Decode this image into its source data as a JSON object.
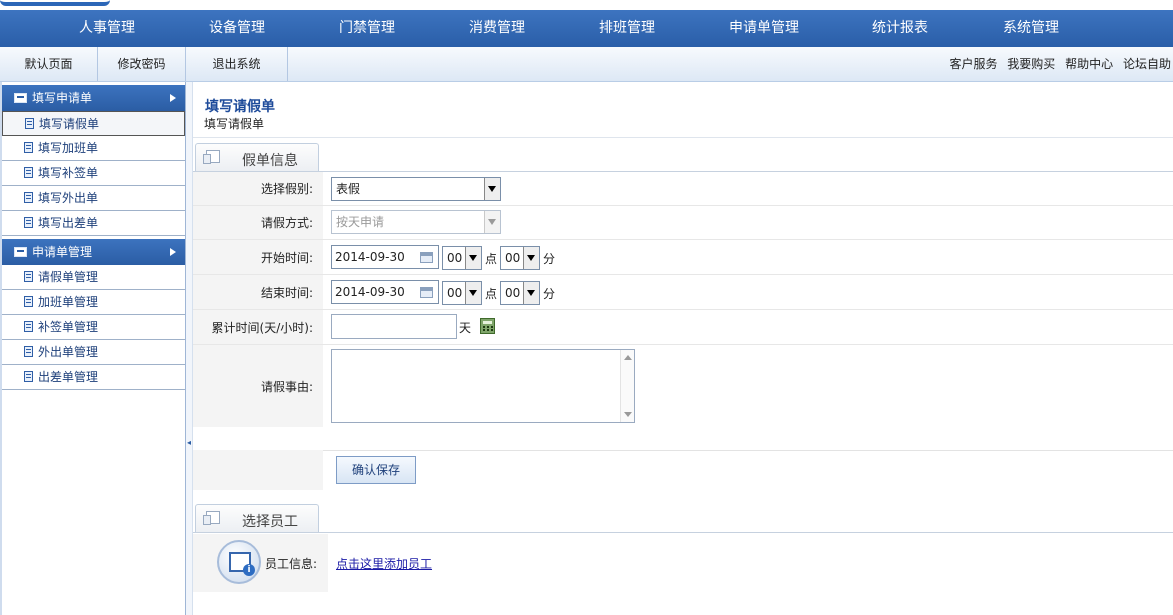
{
  "main_nav": [
    "人事管理",
    "设备管理",
    "门禁管理",
    "消费管理",
    "排班管理",
    "申请单管理",
    "统计报表",
    "系统管理"
  ],
  "sub_tabs": [
    "默认页面",
    "修改密码",
    "退出系统"
  ],
  "top_links": [
    "客户服务",
    "我要购买",
    "帮助中心",
    "论坛自助"
  ],
  "sidebar": {
    "group1": "填写申请单",
    "group1_items": [
      "填写请假单",
      "填写加班单",
      "填写补签单",
      "填写外出单",
      "填写出差单"
    ],
    "group2": "申请单管理",
    "group2_items": [
      "请假单管理",
      "加班单管理",
      "补签单管理",
      "外出单管理",
      "出差单管理"
    ]
  },
  "page": {
    "title": "填写请假单",
    "subtitle": "填写请假单"
  },
  "section1": {
    "label": "假单信息"
  },
  "form": {
    "leave_type_label": "选择假别:",
    "leave_type_value": "表假",
    "leave_mode_label": "请假方式:",
    "leave_mode_value": "按天申请",
    "start_label": "开始时间:",
    "start_date": "2014-09-30",
    "start_hour": "00",
    "start_min": "00",
    "end_label": "结束时间:",
    "end_date": "2014-09-30",
    "end_hour": "00",
    "end_min": "00",
    "hour_unit": "点",
    "min_unit": "分",
    "total_label": "累计时间(天/小时):",
    "total_unit": "天",
    "reason_label": "请假事由:"
  },
  "save_label": "确认保存",
  "section2": {
    "label": "选择员工"
  },
  "employee": {
    "label": "员工信息:",
    "link": "点击这里添加员工"
  }
}
